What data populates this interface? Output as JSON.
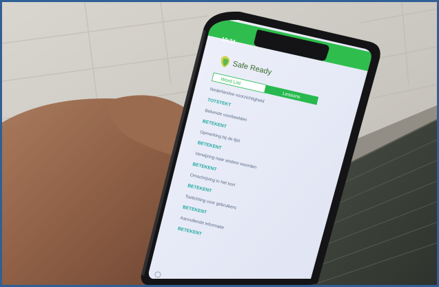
{
  "phone": {
    "status_time": "10:34",
    "app_title": "Safe Ready",
    "segment": {
      "left_label": "Word List",
      "right_label": "Lessons"
    },
    "list": [
      {
        "body": "Nederlandse voorzichtigheid",
        "link": "TOTSTEKT"
      },
      {
        "body": "Bekende voorbeelden",
        "link": "BETEKENT"
      },
      {
        "body": "Opmerking bij de lijst",
        "link": "BETEKENT"
      },
      {
        "body": "Verwijzing naar andere woorden",
        "link": "BETEKENT"
      },
      {
        "body": "Omschrijving in het kort",
        "link": "BETEKENT"
      },
      {
        "body": "Toelichting voor gebruikers",
        "link": "BETEKENT"
      },
      {
        "body": "Aanvullende informatie",
        "link": "BETEKENT"
      }
    ]
  },
  "colors": {
    "frame": "#2f5f95",
    "status_bar": "#2fbe4e",
    "accent_green": "#27b94f",
    "link_teal": "#22a9a2",
    "screen_bg": "#e9ecf7"
  }
}
